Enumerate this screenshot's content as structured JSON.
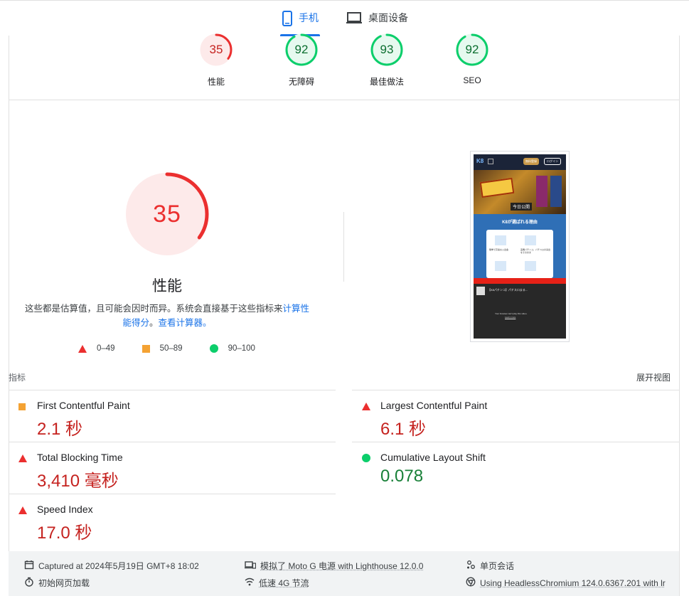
{
  "tabs": [
    {
      "label": "手机",
      "active": true,
      "icon": "phone-icon"
    },
    {
      "label": "桌面设备",
      "active": false,
      "icon": "laptop-icon"
    }
  ],
  "categories": [
    {
      "score": "35",
      "label": "性能",
      "color": "#eb2f2f",
      "value": 35
    },
    {
      "score": "92",
      "label": "无障碍",
      "color": "#0cce6b",
      "value": 92
    },
    {
      "score": "93",
      "label": "最佳做法",
      "color": "#0cce6b",
      "value": 93
    },
    {
      "score": "92",
      "label": "SEO",
      "color": "#0cce6b",
      "value": 92
    }
  ],
  "performance": {
    "score": "35",
    "value": 35,
    "title": "性能",
    "desc_text": "这些都是估算值，且可能会因时而异。系统会直接基于这些指标来",
    "desc_link1": "计算性能得分",
    "desc_mid": "。",
    "desc_link2": "查看计算器。"
  },
  "legend": [
    {
      "shape": "triangle",
      "label": "0–49",
      "color": "#eb2f2f"
    },
    {
      "shape": "square",
      "label": "50–89",
      "color": "#f4a233"
    },
    {
      "shape": "circle",
      "label": "90–100",
      "color": "#0cce6b"
    }
  ],
  "metrics_section": {
    "title": "指标",
    "expand": "展开视图"
  },
  "metrics": [
    {
      "name": "First Contentful Paint",
      "value": "2.1 秒",
      "rating": "average"
    },
    {
      "name": "Largest Contentful Paint",
      "value": "6.1 秒",
      "rating": "fail"
    },
    {
      "name": "Total Blocking Time",
      "value": "3,410 毫秒",
      "rating": "fail"
    },
    {
      "name": "Cumulative Layout Shift",
      "value": "0.078",
      "rating": "pass"
    },
    {
      "name": "Speed Index",
      "value": "17.0 秒",
      "rating": "fail"
    }
  ],
  "footer": {
    "captured": "Captured at 2024年5月19日 GMT+8 18:02",
    "initial_load": "初始网页加载",
    "emulated": "模拟了 Moto G 电源 with Lighthouse 12.0.0",
    "throttling": "低速 4G 节流",
    "session": "单页会话",
    "browser": "Using HeadlessChromium 124.0.6367.201 with lr"
  },
  "thumbnail": {
    "logo": "K8",
    "btn1": "無料登録",
    "btn2": "ログイン",
    "banner": "今日公開",
    "section_title": "K8が選ばれる理由",
    "feat1": "簡単で高速な入出金",
    "feat2": "実機パチンコ、パチスロの演出をそのまま",
    "video_title": "【K8パチンコ】パチスロまる...",
    "video_msg": "Your browser can't play this video.",
    "video_link": "Learn more"
  }
}
